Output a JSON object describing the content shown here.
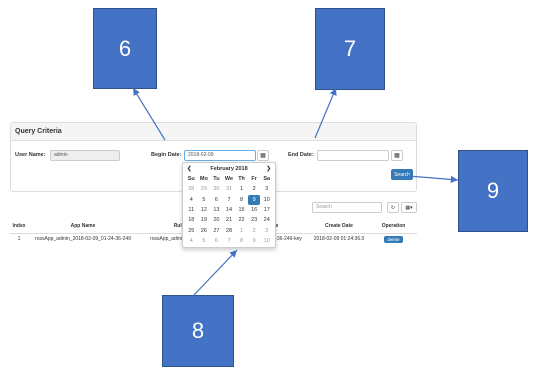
{
  "panel": {
    "title": "Query Criteria",
    "user_name_label": "User Name:",
    "user_name_value": "admin",
    "begin_date_label": "Begin Date:",
    "begin_date_value": "2018-02-09",
    "end_date_label": "End Date:",
    "end_date_value": "",
    "calendar_glyph": "▦",
    "search_label": "Search"
  },
  "toolbar": {
    "search_placeholder": "Search",
    "refresh_glyph": "↻",
    "columns_glyph": "▦▾"
  },
  "table": {
    "headers": [
      "Index",
      "App Name",
      "Rule Na",
      "ey Name",
      "Create Date",
      "Operation"
    ],
    "row": {
      "index": "1",
      "app_name": "rossApp_admin_2018-02-09_01-24-36-249",
      "rule_name": "rossApp_admin_2018-36-249",
      "key_name": "2018-02-09_01-24-36-249-key",
      "create_date": "2018-02-09 01:24:36.0",
      "operation": "delete"
    }
  },
  "datepicker": {
    "prev": "❮",
    "next": "❯",
    "month_label": "February 2018",
    "weekdays": [
      "Su",
      "Mo",
      "Tu",
      "We",
      "Th",
      "Fr",
      "Sa"
    ],
    "weeks": [
      [
        "28",
        "29",
        "30",
        "31",
        "1",
        "2",
        "3"
      ],
      [
        "4",
        "5",
        "6",
        "7",
        "8",
        "9",
        "10"
      ],
      [
        "11",
        "12",
        "13",
        "14",
        "15",
        "16",
        "17"
      ],
      [
        "18",
        "19",
        "20",
        "21",
        "22",
        "23",
        "24"
      ],
      [
        "25",
        "26",
        "27",
        "28",
        "1",
        "2",
        "3"
      ],
      [
        "4",
        "5",
        "6",
        "7",
        "8",
        "9",
        "10"
      ]
    ],
    "selected": "9"
  },
  "callouts": {
    "c6": "6",
    "c7": "7",
    "c8": "8",
    "c9": "9"
  },
  "colors": {
    "callout": "#4472c4",
    "primary": "#337ab7"
  }
}
